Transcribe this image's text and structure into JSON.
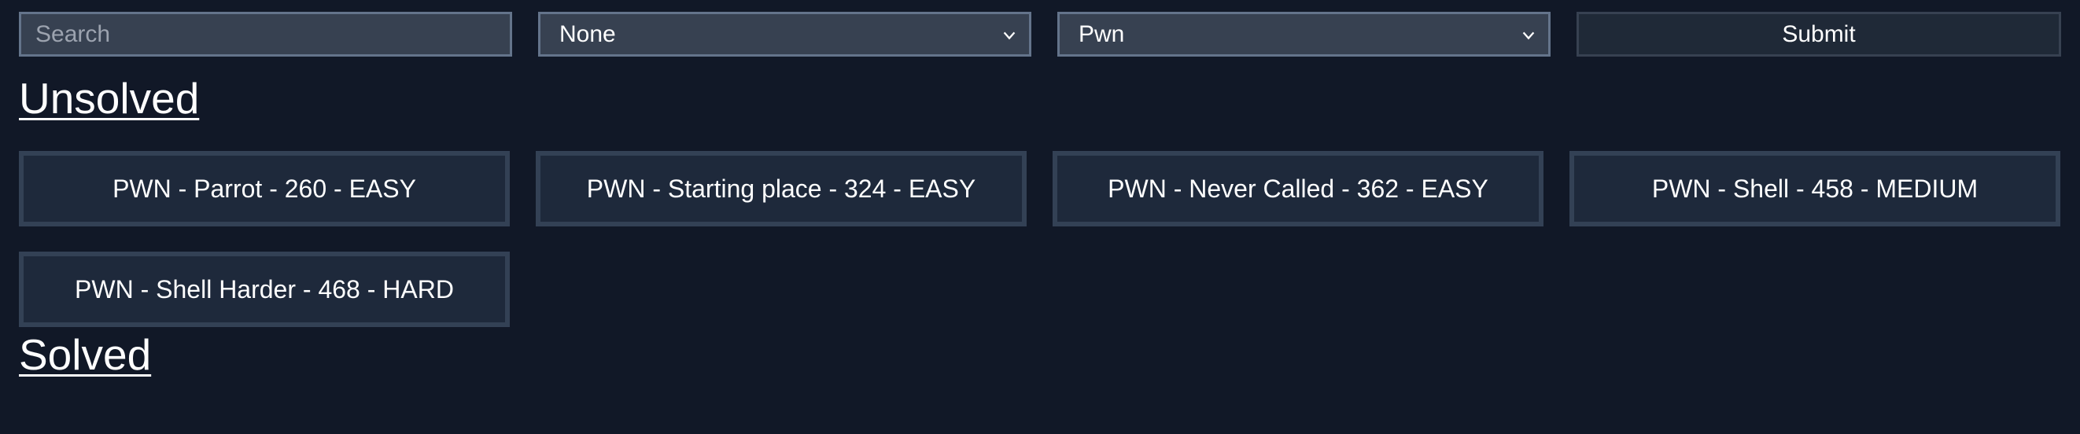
{
  "filters": {
    "search_placeholder": "Search",
    "category_select": {
      "selected": "None"
    },
    "type_select": {
      "selected": "Pwn"
    },
    "submit_label": "Submit"
  },
  "sections": {
    "unsolved_title": "Unsolved",
    "solved_title": "Solved"
  },
  "unsolved_challenges": [
    {
      "label": "PWN - Parrot - 260 - EASY"
    },
    {
      "label": "PWN - Starting place - 324 - EASY"
    },
    {
      "label": "PWN - Never Called - 362 - EASY"
    },
    {
      "label": "PWN - Shell - 458 - MEDIUM"
    },
    {
      "label": "PWN - Shell Harder - 468 - HARD"
    }
  ],
  "icons": {
    "select_arrow": "chevron-down-icon"
  },
  "colors": {
    "background": "#111827",
    "field_bg": "#374151",
    "card_bg": "#1e293b",
    "card_border": "#334155"
  }
}
